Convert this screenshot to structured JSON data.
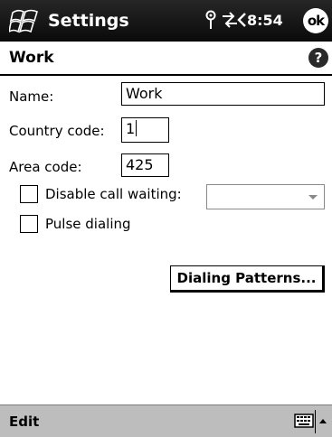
{
  "titlebar": {
    "app_title": "Settings",
    "clock": "8:54",
    "ok_label": "ok",
    "icons": [
      "start-flag-icon",
      "antenna-icon",
      "connectivity-icon",
      "speaker-icon"
    ]
  },
  "page": {
    "title": "Work",
    "help_label": "?"
  },
  "form": {
    "name_label": "Name:",
    "name_value": "Work",
    "country_code_label": "Country code:",
    "country_code_value": "1",
    "area_code_label": "Area code:",
    "area_code_value": "425",
    "disable_call_waiting_label": "Disable call waiting:",
    "disable_call_waiting_checked": false,
    "disable_call_waiting_value": "",
    "pulse_dialing_label": "Pulse dialing",
    "pulse_dialing_checked": false,
    "dialing_patterns_button": "Dialing Patterns..."
  },
  "menubar": {
    "edit_label": "Edit"
  },
  "colors": {
    "titlebar": "#121212",
    "menubar": "#bdbdbd",
    "disabled": "#8a8a8a"
  }
}
